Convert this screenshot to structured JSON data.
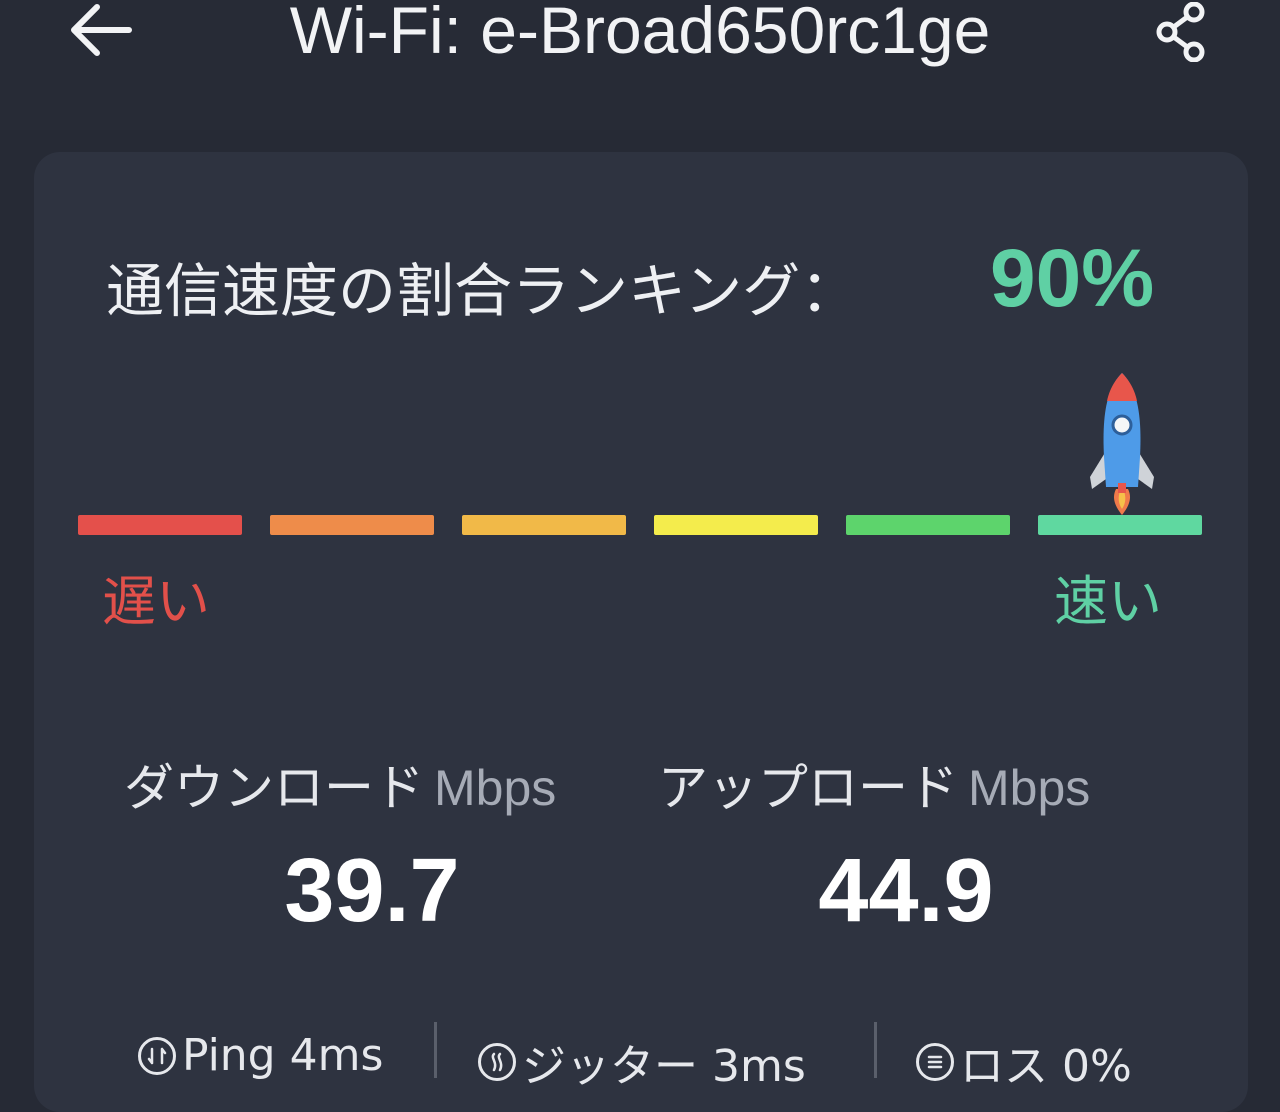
{
  "header": {
    "title": "Wi-Fi: e-Broad650rc1ge"
  },
  "ranking": {
    "label": "通信速度の割合ランキング：",
    "value": "90%",
    "level": 0.9,
    "slow_label": "遅い",
    "fast_label": "速い",
    "segment_colors": [
      "#e4504b",
      "#ee8c4a",
      "#f1b948",
      "#f4ec4c",
      "#5dd46c",
      "#5fd8a0"
    ]
  },
  "download": {
    "label": "ダウンロード",
    "unit": "Mbps",
    "value": "39.7"
  },
  "upload": {
    "label": "アップロード",
    "unit": "Mbps",
    "value": "44.9"
  },
  "stats": {
    "ping": "Ping 4ms",
    "jitter": "ジッター 3ms",
    "loss": "ロス 0%"
  },
  "colors": {
    "background": "#262a35",
    "card": "#2e3340",
    "accent": "#5fd0a4",
    "slow": "#e2504a"
  },
  "icons": [
    "back-arrow-icon",
    "share-icon",
    "rocket-icon",
    "ping-icon",
    "jitter-icon",
    "loss-icon"
  ]
}
